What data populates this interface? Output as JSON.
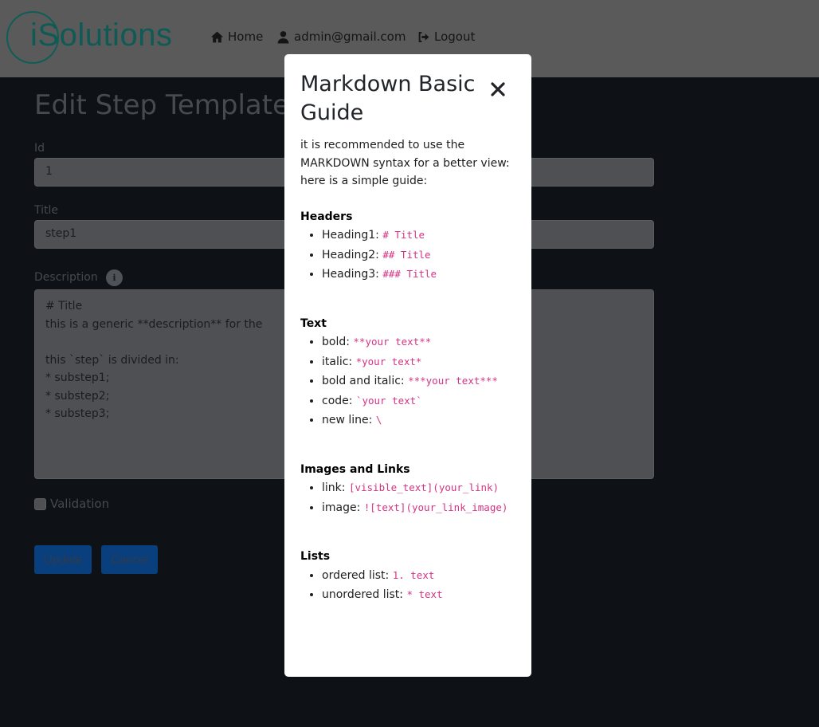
{
  "navbar": {
    "logo_text": "iSolutions",
    "home_label": "Home",
    "user_label": "admin@gmail.com",
    "logout_label": "Logout"
  },
  "page": {
    "title": "Edit Step Template",
    "id_label": "Id",
    "id_value": "1",
    "title_label": "Title",
    "title_value": "step1",
    "description_label": "Description",
    "description_value": "# Title\nthis is a generic **description** for the\n\nthis `step` is divided in:\n* substep1;\n* substep2;\n* substep3;",
    "validation_label": "Validation",
    "update_label": "Update",
    "cancel_label": "Cancel"
  },
  "modal": {
    "title": "Markdown Basic Guide",
    "intro_1": "it is recommended to use the MARKDOWN syntax for a better view:",
    "intro_2": "here is a simple guide:",
    "sections": [
      {
        "heading": "Headers",
        "items": [
          {
            "label": "Heading1: ",
            "code": "# Title"
          },
          {
            "label": "Heading2: ",
            "code": "## Title"
          },
          {
            "label": "Heading3: ",
            "code": "### Title"
          }
        ]
      },
      {
        "heading": "Text",
        "items": [
          {
            "label": "bold: ",
            "code": "**your text**"
          },
          {
            "label": "italic: ",
            "code": "*your text*"
          },
          {
            "label": "bold and italic: ",
            "code": "***your text***"
          },
          {
            "label": "code: ",
            "code": "`your text`"
          },
          {
            "label": "new line: ",
            "code": "\\"
          }
        ]
      },
      {
        "heading": "Images and Links",
        "items": [
          {
            "label": "link: ",
            "code": "[visible_text](your_link)"
          },
          {
            "label": "image: ",
            "code": "![text](your_link_image)"
          }
        ]
      },
      {
        "heading": "Lists",
        "items": [
          {
            "label": "ordered list: ",
            "code": "1. text"
          },
          {
            "label": "unordered list: ",
            "code": "* text"
          }
        ]
      }
    ]
  },
  "colors": {
    "overlay_bg": "#0e1217",
    "navbar_bg": "#5a5a5a",
    "code_pink": "#d63384",
    "logo_teal": "#0f5a55",
    "button_blue": "#083f7c"
  }
}
